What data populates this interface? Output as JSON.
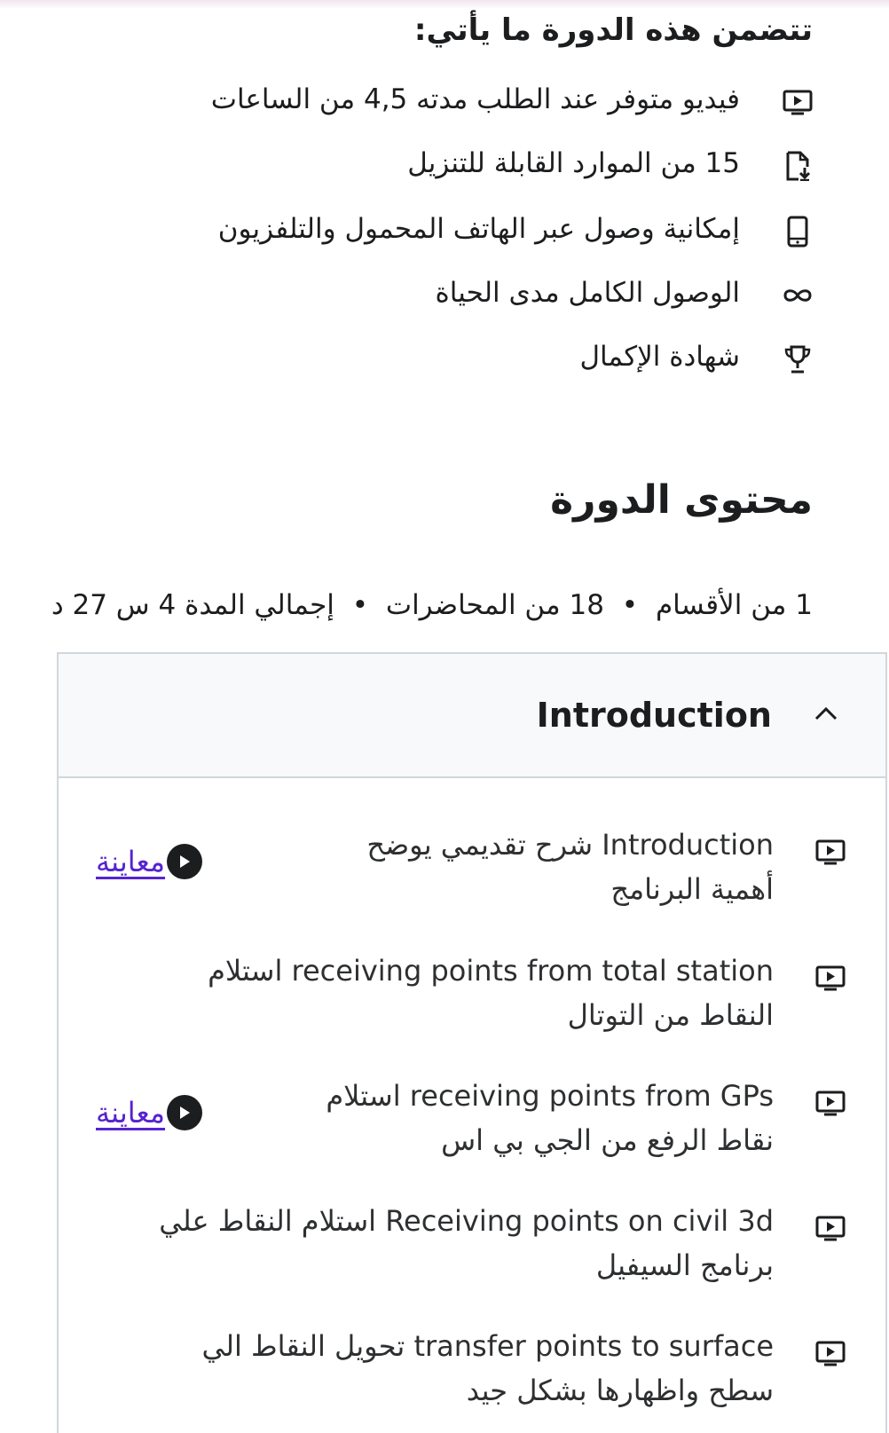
{
  "includes": {
    "title": "تتضمن هذه الدورة ما يأتي:",
    "items": [
      {
        "icon": "video-icon",
        "text": "فيديو متوفر عند الطلب مدته 4,5 من الساعات"
      },
      {
        "icon": "download-file-icon",
        "text": "15 من الموارد القابلة للتنزيل"
      },
      {
        "icon": "mobile-icon",
        "text": "إمكانية وصول عبر الهاتف المحمول والتلفزيون"
      },
      {
        "icon": "infinity-icon",
        "text": "الوصول الكامل مدى الحياة"
      },
      {
        "icon": "trophy-icon",
        "text": "شهادة الإكمال"
      }
    ]
  },
  "course_content": {
    "title": "محتوى الدورة",
    "summary": {
      "sections": "1 من الأقسام",
      "lectures": "18 من المحاضرات",
      "duration": "إجمالي المدة 4 س 27 د",
      "separator": "•"
    },
    "section": {
      "title": "Introduction",
      "expanded": true,
      "chevron_icon": "chevron-up-icon",
      "lectures": [
        {
          "title": "Introduction شرح تقديمي يوضح أهمية البرنامج",
          "preview": "معاينة"
        },
        {
          "title": "receiving points from total station استلام النقاط من التوتال"
        },
        {
          "title": "receiving points from GPs استلام نقاط الرفع من الجي بي اس",
          "preview": "معاينة"
        },
        {
          "title": "Receiving points on civil 3d استلام النقاط علي برنامج السيفيل"
        },
        {
          "title": "transfer points to surface تحويل النقاط الي سطح واظهارها بشكل جيد"
        }
      ]
    }
  },
  "colors": {
    "text": "#1c1d1f",
    "link": "#5624d0",
    "header_bg": "#f7f9fa",
    "border": "#d1d7dc"
  }
}
